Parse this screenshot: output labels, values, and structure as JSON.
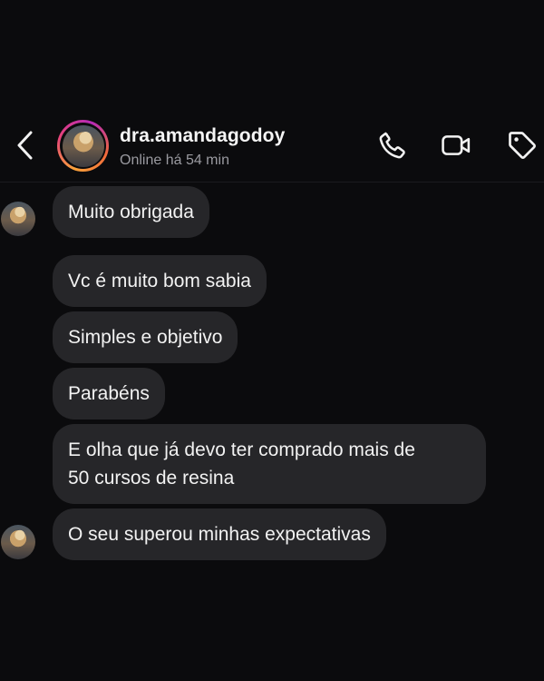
{
  "header": {
    "username": "dra.amandagodoy",
    "status": "Online há 54 min"
  },
  "icons": {
    "back": "chevron-left-icon",
    "call": "phone-icon",
    "video": "video-camera-icon",
    "tag": "tag-icon"
  },
  "colors": {
    "background": "#0b0b0d",
    "bubble": "#262629",
    "text": "#f2f2f2",
    "secondary_text": "#9a9aa0",
    "story_ring": [
      "#f9a23a",
      "#e6437a",
      "#b62ab7"
    ]
  },
  "messages": [
    {
      "text": "Muito obrigada"
    },
    {
      "text": "Vc é muito bom sabia"
    },
    {
      "text": "Simples e objetivo"
    },
    {
      "text": "Parabéns"
    },
    {
      "text": "E olha que já devo ter comprado mais de\n50 cursos de resina"
    },
    {
      "text": "O seu superou minhas expectativas"
    }
  ]
}
